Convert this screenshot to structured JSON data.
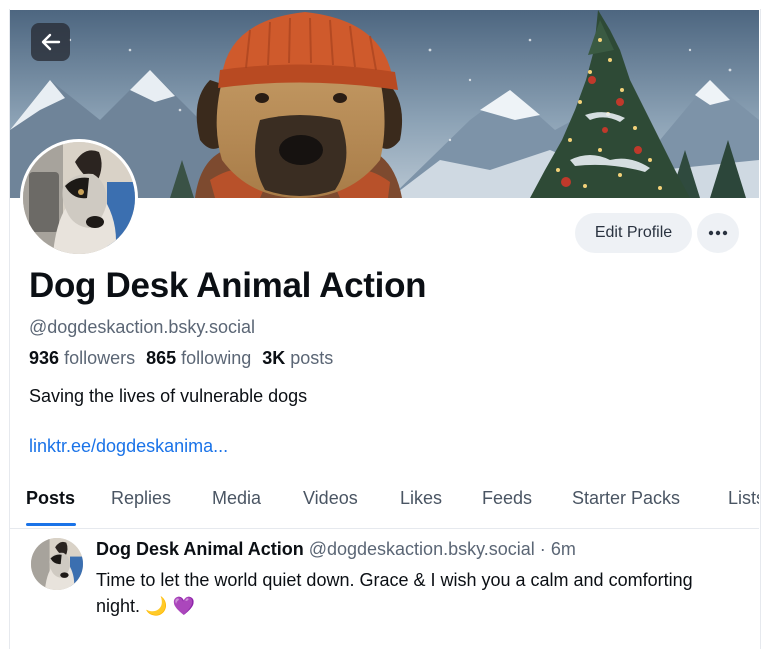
{
  "profile": {
    "display_name": "Dog Desk Animal Action",
    "handle": "@dogdeskaction.bsky.social",
    "followers_count": "936",
    "followers_label": "followers",
    "following_count": "865",
    "following_label": "following",
    "posts_count": "3K",
    "posts_label": "posts",
    "bio": "Saving the lives of vulnerable dogs",
    "link": "linktr.ee/dogdeskanima..."
  },
  "actions": {
    "edit_profile_label": "Edit Profile",
    "back_icon": "arrow-left-icon",
    "more_icon": "ellipsis-icon"
  },
  "tabs": [
    {
      "label": "Posts",
      "active": true
    },
    {
      "label": "Replies",
      "active": false
    },
    {
      "label": "Media",
      "active": false
    },
    {
      "label": "Videos",
      "active": false
    },
    {
      "label": "Likes",
      "active": false
    },
    {
      "label": "Feeds",
      "active": false
    },
    {
      "label": "Starter Packs",
      "active": false
    },
    {
      "label": "Lists",
      "active": false
    }
  ],
  "post": {
    "author_name": "Dog Desk Animal Action",
    "author_handle": "@dogdeskaction.bsky.social",
    "time_ago": "6m",
    "text": "Time to let the world quiet down. Grace & I wish you a calm and comforting night. 🌙 💜"
  },
  "colors": {
    "accent": "#1a73e8",
    "button_bg": "#eef1f5",
    "muted_text": "#5b6675"
  }
}
